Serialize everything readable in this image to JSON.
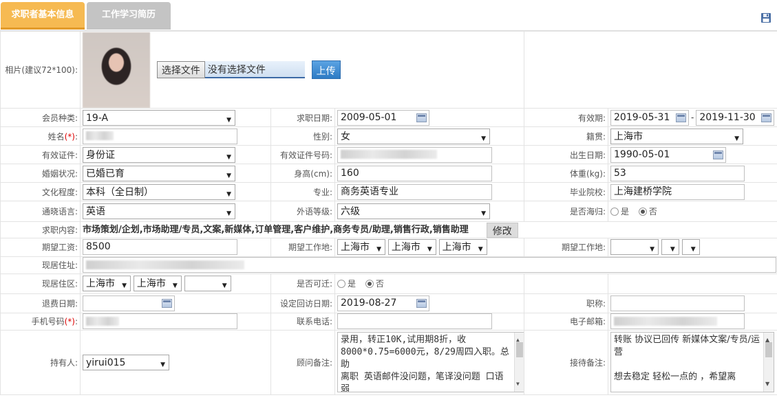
{
  "tabs": [
    {
      "label": "求职者基本信息",
      "active": true
    },
    {
      "label": "工作学习简历",
      "active": false
    }
  ],
  "icons": {
    "save": "save-disk-icon",
    "calendar": "calendar-icon"
  },
  "colors": {
    "tab_active": "#f6ba52",
    "tab_inactive": "#c4c4c4",
    "upload_button": "#2d7bc4",
    "required": "#dd0000"
  },
  "photo": {
    "label": "相片(建议72*100):",
    "choose_button": "选择文件",
    "file_status": "没有选择文件",
    "upload_button": "上传"
  },
  "fields": {
    "member_type": {
      "label": "会员种类:",
      "value": "19-A"
    },
    "apply_date": {
      "label": "求职日期:",
      "value": "2009-05-01"
    },
    "validity": {
      "label": "有效期:",
      "start": "2019-05-31",
      "sep": "-",
      "end": "2019-11-30"
    },
    "name": {
      "label": "姓名",
      "required": "(*)",
      "colon": ":"
    },
    "gender": {
      "label": "性别:",
      "value": "女"
    },
    "native_place": {
      "label": "籍贯:",
      "value": "上海市"
    },
    "id_type": {
      "label": "有效证件:",
      "value": "身份证"
    },
    "id_number": {
      "label": "有效证件号码:"
    },
    "birth_date": {
      "label": "出生日期:",
      "value": "1990-05-01"
    },
    "marital": {
      "label": "婚姻状况:",
      "value": "已婚已育"
    },
    "height": {
      "label": "身高(cm):",
      "value": "160"
    },
    "weight": {
      "label": "体重(kg):",
      "value": "53"
    },
    "education": {
      "label": "文化程度:",
      "value": "本科（全日制）"
    },
    "major": {
      "label": "专业:",
      "value": "商务英语专业"
    },
    "school": {
      "label": "毕业院校:",
      "value": "上海建桥学院"
    },
    "language": {
      "label": "通晓语言:",
      "value": "英语"
    },
    "foreign_level": {
      "label": "外语等级:",
      "value": "六级"
    },
    "returnee": {
      "label": "是否海归:",
      "yes": "是",
      "no": "否",
      "selected": "否"
    },
    "job_intent": {
      "label": "求职内容:",
      "value": "市场策划/企划,市场助理/专员,文案,新媒体,订单管理,客户维护,商务专员/助理,销售行政,销售助理",
      "modify": "修改"
    },
    "expected_salary": {
      "label": "期望工资:",
      "value": "8500"
    },
    "expected_location": {
      "label": "期望工作地:",
      "province": "上海市",
      "city": "上海市",
      "district": "上海市"
    },
    "expected_location2": {
      "label": "期望工作地:"
    },
    "address": {
      "label": "现居住址:"
    },
    "residence_area": {
      "label": "现居住区:",
      "province": "上海市",
      "city": "上海市",
      "district": ""
    },
    "relocate": {
      "label": "是否可迁:",
      "yes": "是",
      "no": "否",
      "selected": "否"
    },
    "refund_date": {
      "label": "退费日期:",
      "value": ""
    },
    "follow_up_date": {
      "label": "设定回访日期:",
      "value": "2019-08-27"
    },
    "title": {
      "label": "职称:",
      "value": ""
    },
    "mobile": {
      "label": "手机号码",
      "required": "(*)",
      "colon": ":"
    },
    "phone": {
      "label": "联系电话:",
      "value": ""
    },
    "email": {
      "label": "电子邮箱:"
    },
    "owner": {
      "label": "持有人:",
      "value": "yirui015"
    },
    "consultant_note": {
      "label": "顾问备注:",
      "value": "录用，转正10K,试用期8折，收8000*0.75=6000元，8/29周四入职。总助\n离职 英语邮件没问题，笔译没问题 口语弱"
    },
    "reception_note": {
      "label": "接待备注:",
      "value": "转账 协议已回传 新媒体文案/专员/运营\n\n想去稳定 轻松一点的 ，希望离"
    }
  }
}
